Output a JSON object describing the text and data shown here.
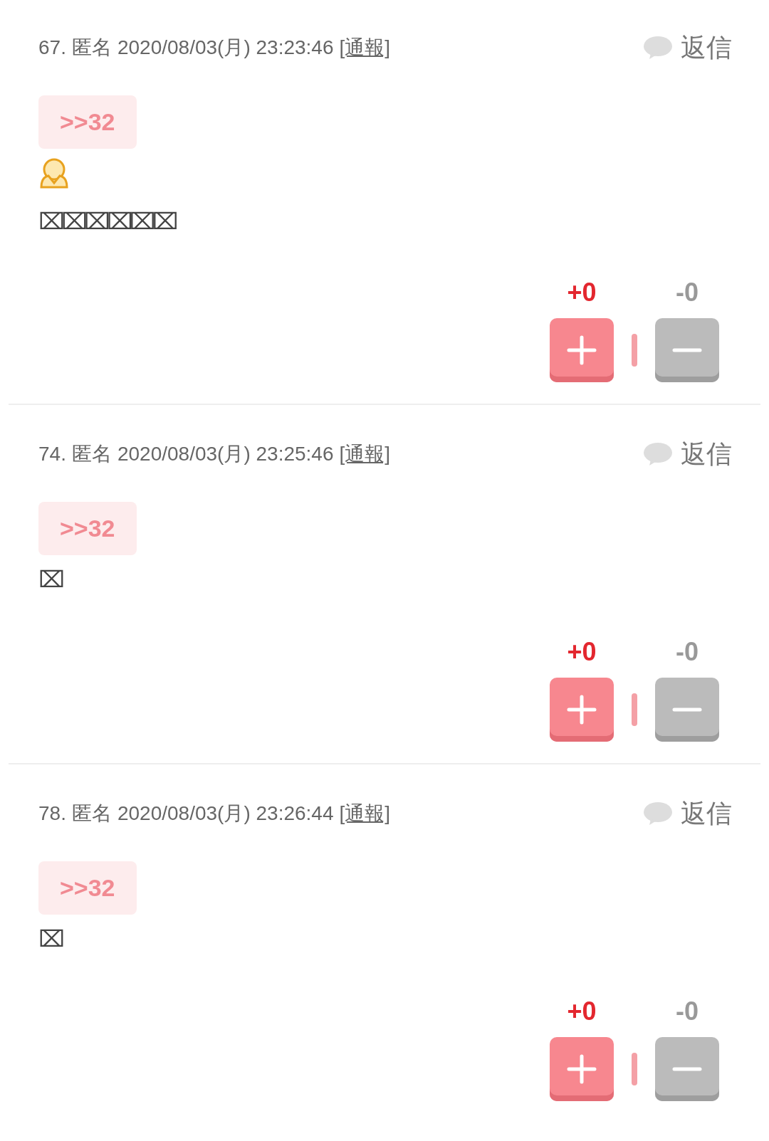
{
  "posts": [
    {
      "number": "67.",
      "author": "匿名",
      "datetime": "2020/08/03(月) 23:23:46",
      "report": "[通報]",
      "reply": "返信",
      "anchor": ">>32",
      "emoji": true,
      "body": "⌧⌧⌧⌧⌧⌧",
      "plus": "+0",
      "minus": "-0"
    },
    {
      "number": "74.",
      "author": "匿名",
      "datetime": "2020/08/03(月) 23:25:46",
      "report": "[通報]",
      "reply": "返信",
      "anchor": ">>32",
      "emoji": false,
      "body": "⌧",
      "plus": "+0",
      "minus": "-0"
    },
    {
      "number": "78.",
      "author": "匿名",
      "datetime": "2020/08/03(月) 23:26:44",
      "report": "[通報]",
      "reply": "返信",
      "anchor": ">>32",
      "emoji": false,
      "body": "⌧",
      "plus": "+0",
      "minus": "-0"
    }
  ]
}
